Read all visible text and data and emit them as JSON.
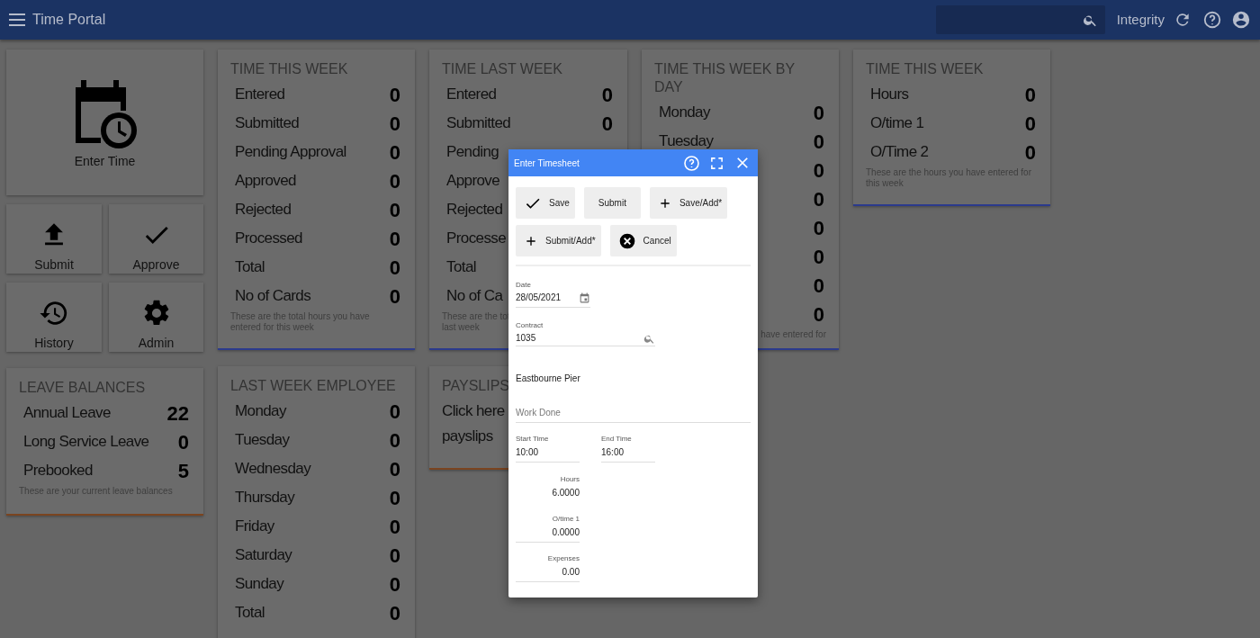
{
  "header": {
    "title": "Time Portal",
    "brand": "Integrity"
  },
  "tiles": [
    {
      "label": "Enter Time",
      "kind": "calendar-clock"
    },
    {
      "label": "Submit",
      "kind": "upload"
    },
    {
      "label": "Approve",
      "kind": "check"
    },
    {
      "label": "History",
      "kind": "history"
    },
    {
      "label": "Admin",
      "kind": "gear"
    }
  ],
  "leave_balances": {
    "title": "LEAVE BALANCES",
    "color": "#7a4420",
    "rows": [
      {
        "label": "Annual Leave",
        "value": "22"
      },
      {
        "label": "Long Service Leave",
        "value": "0"
      },
      {
        "label": "Prebooked",
        "value": "5"
      }
    ],
    "note": "These are your current leave balances"
  },
  "card_columns": [
    [
      {
        "title": "TIME THIS WEEK",
        "color": "#2b3a8c",
        "rows": [
          {
            "label": "Entered",
            "value": "0"
          },
          {
            "label": "Submitted",
            "value": "0"
          },
          {
            "label": "Pending Approval",
            "value": "0"
          },
          {
            "label": "Approved",
            "value": "0"
          },
          {
            "label": "Rejected",
            "value": "0"
          },
          {
            "label": "Processed",
            "value": "0"
          },
          {
            "label": "Total",
            "value": "0"
          },
          {
            "label": "No of Cards",
            "value": "0"
          }
        ],
        "note": "These are the total hours you have entered for this week"
      },
      {
        "title": "LAST WEEK EMPLOYEE",
        "rows": [
          {
            "label": "Monday",
            "value": "0"
          },
          {
            "label": "Tuesday",
            "value": "0"
          },
          {
            "label": "Wednesday",
            "value": "0"
          },
          {
            "label": "Thursday",
            "value": "0"
          },
          {
            "label": "Friday",
            "value": "0"
          },
          {
            "label": "Saturday",
            "value": "0"
          },
          {
            "label": "Sunday",
            "value": "0"
          },
          {
            "label": "Total",
            "value": "0"
          }
        ]
      }
    ],
    [
      {
        "title": "TIME LAST WEEK",
        "color": "#2b3a8c",
        "rows": [
          {
            "label": "Entered",
            "value": "0"
          },
          {
            "label": "Submitted",
            "value": "0"
          },
          {
            "label": "Pending"
          },
          {
            "label": "Approve"
          },
          {
            "label": "Rejected"
          },
          {
            "label": "Processe"
          },
          {
            "label": "Total"
          },
          {
            "label": "No of Ca"
          }
        ],
        "note": "These are the tot",
        "note2": "last week"
      },
      {
        "title": "PAYSLIPS",
        "color": "#7a4420",
        "lines": [
          "Click here",
          "payslips"
        ]
      }
    ],
    [
      {
        "title": "TIME THIS WEEK BY DAY",
        "color": "#2b3a8c",
        "rows": [
          {
            "label": "Monday",
            "value": "0"
          },
          {
            "label": "Tuesday",
            "value": "0"
          },
          {
            "value": "0"
          },
          {
            "value": "0"
          },
          {
            "value": "0"
          },
          {
            "value": "0"
          },
          {
            "value": "0"
          },
          {
            "value": "0"
          }
        ],
        "note": "have entered for",
        "note_clipped": true
      }
    ],
    [
      {
        "title": "TIME THIS WEEK",
        "color": "#2b3a8c",
        "rows": [
          {
            "label": "Hours",
            "value": "0"
          },
          {
            "label": "O/time 1",
            "value": "0"
          },
          {
            "label": "O/Time 2",
            "value": "0"
          }
        ],
        "note": "These are the hours you have entered for this week"
      }
    ]
  ],
  "dialog": {
    "title": "Enter Timesheet",
    "buttons": [
      {
        "label": "Save",
        "kind": "check"
      },
      {
        "label": "Submit",
        "kind": "text"
      },
      {
        "label": "Save/Add*",
        "kind": "plus"
      },
      {
        "label": "Submit/Add*",
        "kind": "plus"
      },
      {
        "label": "Cancel",
        "kind": "cancel"
      }
    ],
    "date": {
      "label": "Date",
      "value": "28/05/2021"
    },
    "contract": {
      "label": "Contract",
      "value": "1035"
    },
    "contract_name": "Eastbourne Pier",
    "work_done": {
      "placeholder": "Work Done"
    },
    "start_time": {
      "label": "Start Time",
      "value": "10:00"
    },
    "end_time": {
      "label": "End Time",
      "value": "16:00"
    },
    "numbers": [
      {
        "label": "Hours",
        "value": "6.0000",
        "underline": false
      },
      {
        "label": "O/time 1",
        "value": "0.0000",
        "underline": true
      },
      {
        "label": "Expenses",
        "value": "0.00",
        "underline": true
      }
    ]
  }
}
